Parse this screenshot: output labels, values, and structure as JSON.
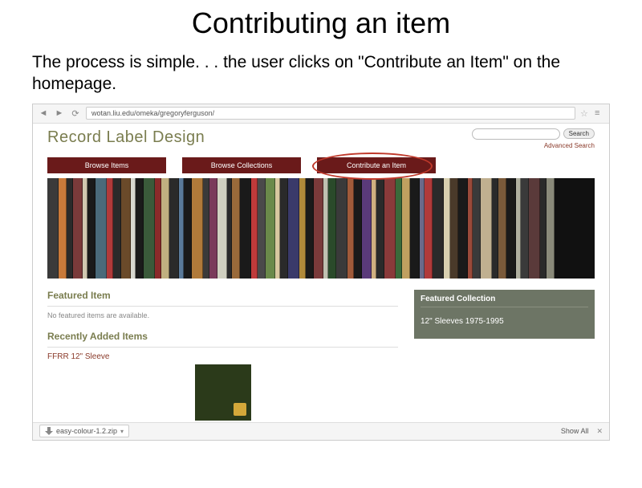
{
  "slide": {
    "title": "Contributing an item",
    "body": "The process is simple. . . the user clicks on \"Contribute an Item\" on the homepage."
  },
  "browser": {
    "url": "wotan.liu.edu/omeka/gregoryferguson/",
    "download_filename": "easy-colour-1.2.zip",
    "show_all_label": "Show All"
  },
  "site": {
    "title": "Record Label Design",
    "search_button": "Search",
    "advanced_search": "Advanced Search",
    "tabs": [
      {
        "label": "Browse Items"
      },
      {
        "label": "Browse Collections"
      },
      {
        "label": "Contribute an Item"
      }
    ],
    "featured_item_heading": "Featured Item",
    "featured_item_text": "No featured items are available.",
    "recently_added_heading": "Recently Added Items",
    "recent_item": "FFRR 12\" Sleeve",
    "featured_collection_heading": "Featured Collection",
    "featured_collection_item": "12\" Sleeves 1975-1995"
  },
  "banner_spines": [
    {
      "w": 14,
      "c": "#3a3a3a"
    },
    {
      "w": 10,
      "c": "#c97a3a"
    },
    {
      "w": 8,
      "c": "#2a2a2a"
    },
    {
      "w": 12,
      "c": "#7a3a3a"
    },
    {
      "w": 6,
      "c": "#d0c8b0"
    },
    {
      "w": 10,
      "c": "#1a1a1a"
    },
    {
      "w": 14,
      "c": "#4a6a7a"
    },
    {
      "w": 8,
      "c": "#b03a3a"
    },
    {
      "w": 10,
      "c": "#2a2a2a"
    },
    {
      "w": 12,
      "c": "#6a4a2a"
    },
    {
      "w": 6,
      "c": "#d8d8d0"
    },
    {
      "w": 10,
      "c": "#1a1a1a"
    },
    {
      "w": 14,
      "c": "#3a5a3a"
    },
    {
      "w": 8,
      "c": "#8a2a2a"
    },
    {
      "w": 10,
      "c": "#c0b080"
    },
    {
      "w": 12,
      "c": "#2a2a2a"
    },
    {
      "w": 6,
      "c": "#5a7a9a"
    },
    {
      "w": 10,
      "c": "#1a1a1a"
    },
    {
      "w": 14,
      "c": "#b07a3a"
    },
    {
      "w": 8,
      "c": "#3a3a3a"
    },
    {
      "w": 10,
      "c": "#7a3a5a"
    },
    {
      "w": 12,
      "c": "#d0d0c0"
    },
    {
      "w": 6,
      "c": "#2a2a2a"
    },
    {
      "w": 10,
      "c": "#9a6a3a"
    },
    {
      "w": 14,
      "c": "#1a1a1a"
    },
    {
      "w": 8,
      "c": "#c03a3a"
    },
    {
      "w": 10,
      "c": "#4a4a4a"
    },
    {
      "w": 12,
      "c": "#6a8a4a"
    },
    {
      "w": 6,
      "c": "#d8c8a0"
    },
    {
      "w": 10,
      "c": "#2a2a2a"
    },
    {
      "w": 14,
      "c": "#3a3a6a"
    },
    {
      "w": 8,
      "c": "#b08a3a"
    },
    {
      "w": 10,
      "c": "#1a1a1a"
    },
    {
      "w": 12,
      "c": "#7a3a3a"
    },
    {
      "w": 6,
      "c": "#c0c0b0"
    },
    {
      "w": 10,
      "c": "#2a4a2a"
    },
    {
      "w": 14,
      "c": "#3a3a3a"
    },
    {
      "w": 8,
      "c": "#a05a3a"
    },
    {
      "w": 10,
      "c": "#1a1a1a"
    },
    {
      "w": 12,
      "c": "#5a3a7a"
    },
    {
      "w": 6,
      "c": "#d0b080"
    },
    {
      "w": 10,
      "c": "#2a2a2a"
    },
    {
      "w": 14,
      "c": "#8a3a3a"
    },
    {
      "w": 8,
      "c": "#3a6a3a"
    },
    {
      "w": 10,
      "c": "#c0a060"
    },
    {
      "w": 12,
      "c": "#1a1a1a"
    },
    {
      "w": 6,
      "c": "#6a6a8a"
    },
    {
      "w": 10,
      "c": "#b03a3a"
    },
    {
      "w": 14,
      "c": "#2a2a2a"
    },
    {
      "w": 8,
      "c": "#d8d0b0"
    },
    {
      "w": 10,
      "c": "#4a3a2a"
    },
    {
      "w": 12,
      "c": "#1a1a1a"
    },
    {
      "w": 6,
      "c": "#9a4a3a"
    },
    {
      "w": 10,
      "c": "#3a3a3a"
    },
    {
      "w": 14,
      "c": "#c0b090"
    },
    {
      "w": 8,
      "c": "#2a2a2a"
    },
    {
      "w": 10,
      "c": "#7a5a3a"
    },
    {
      "w": 12,
      "c": "#1a1a1a"
    },
    {
      "w": 6,
      "c": "#b0b0a0"
    },
    {
      "w": 10,
      "c": "#3a3a3a"
    },
    {
      "w": 14,
      "c": "#5a3a3a"
    },
    {
      "w": 8,
      "c": "#2a2a2a"
    },
    {
      "w": 10,
      "c": "#8a8a7a"
    }
  ]
}
